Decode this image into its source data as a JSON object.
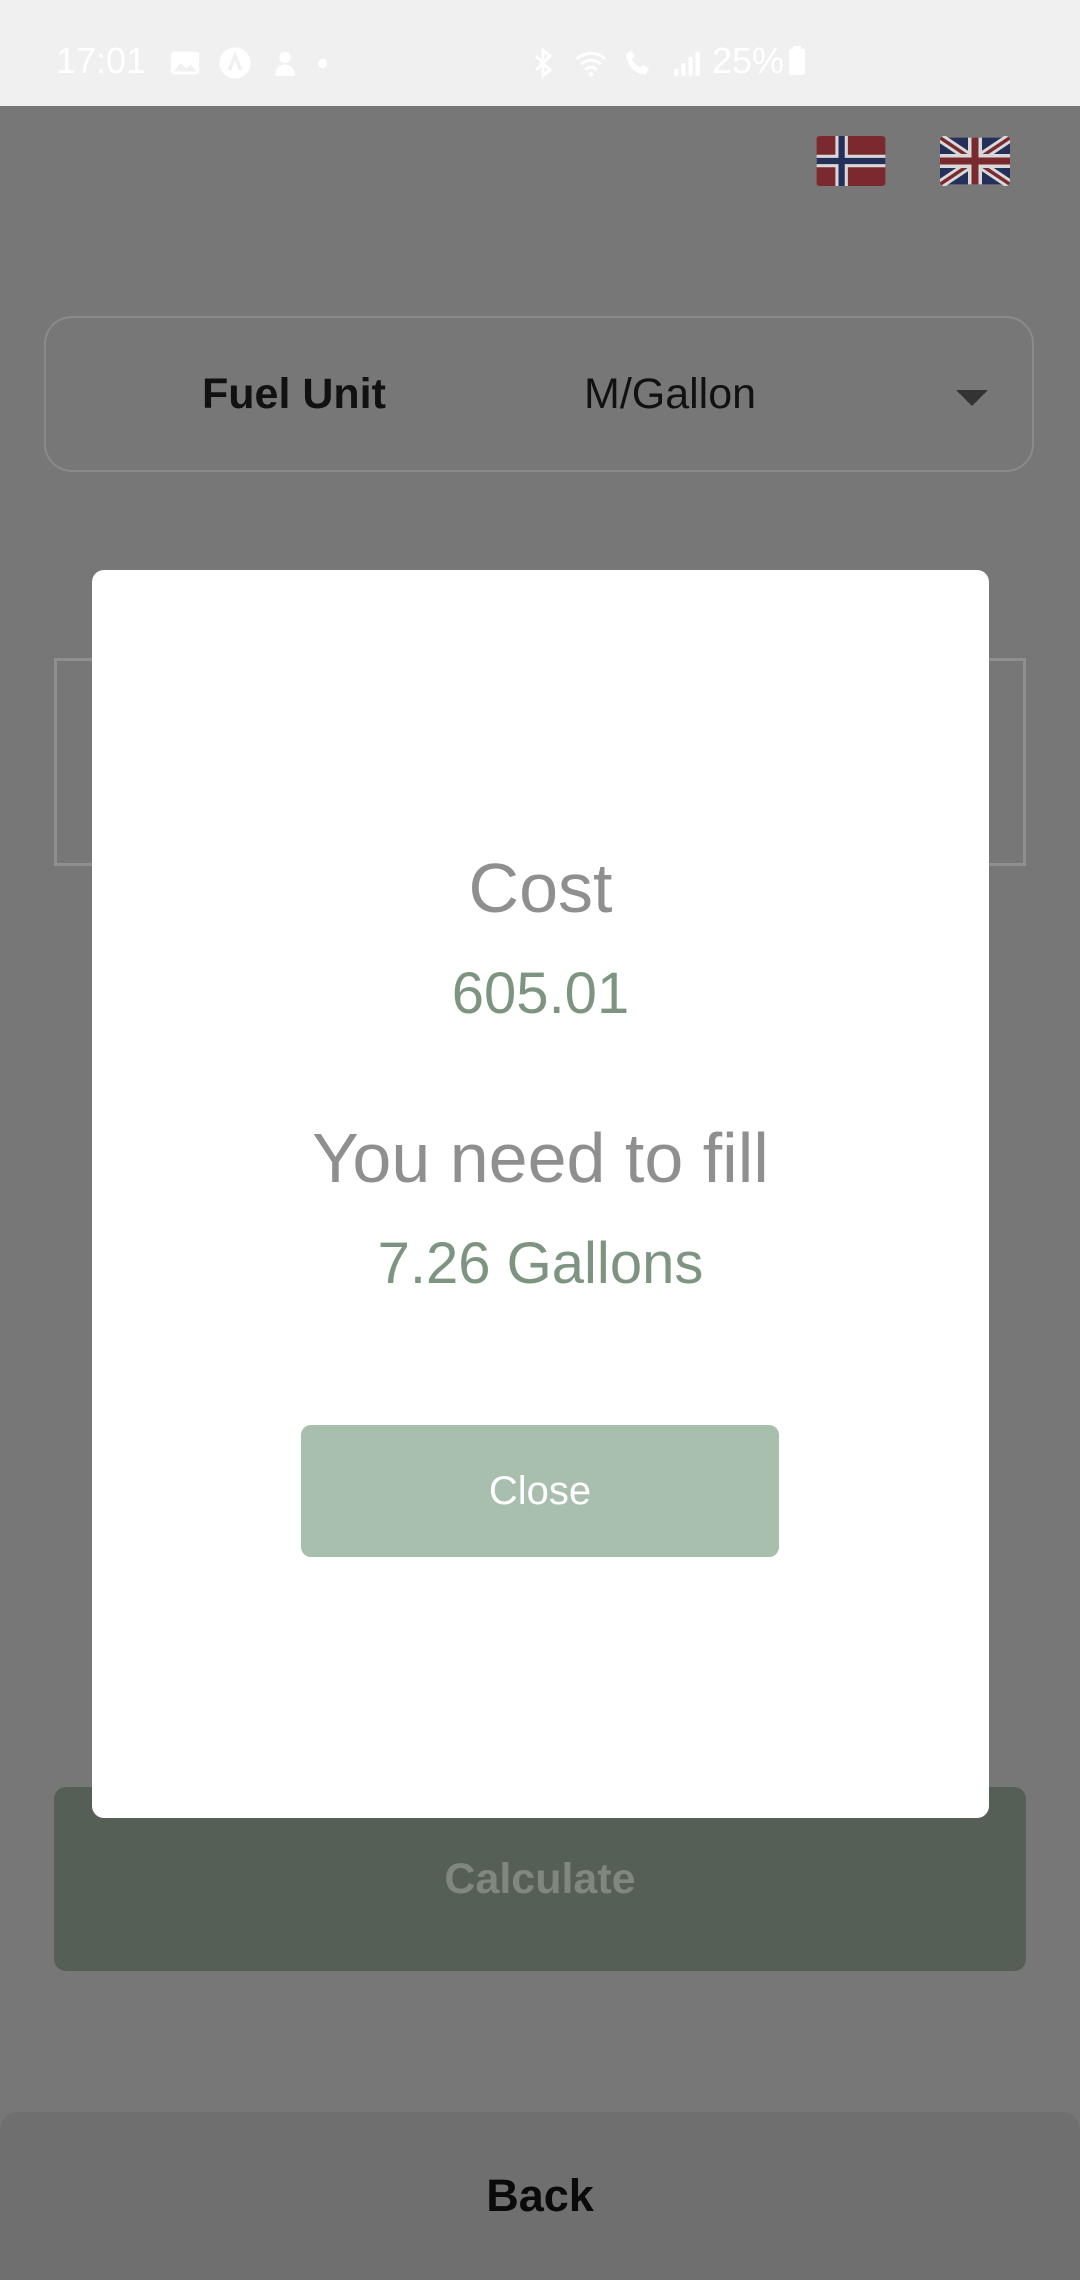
{
  "status_bar": {
    "time": "17:01",
    "battery": "25%",
    "icons_left": [
      "gallery-icon",
      "app-icon",
      "fingerprint-icon"
    ],
    "icons_right": [
      "bluetooth-icon",
      "wifi-icon",
      "wifi-call-icon",
      "signal-icon"
    ]
  },
  "header": {
    "flags": [
      "norway-flag-icon",
      "uk-flag-icon"
    ]
  },
  "fuel_unit": {
    "label": "Fuel Unit",
    "value": "M/Gallon"
  },
  "calculate_label": "Calculate",
  "back_label": "Back",
  "modal": {
    "cost_label": "Cost",
    "cost_value": "605.01",
    "fill_label": "You need to fill",
    "fill_value": "7.26 Gallons",
    "close_label": "Close"
  },
  "colors": {
    "overlay": "#777777",
    "accent": "#a8bfad",
    "value_text": "#7d9480",
    "button_dark": "#555f55"
  }
}
